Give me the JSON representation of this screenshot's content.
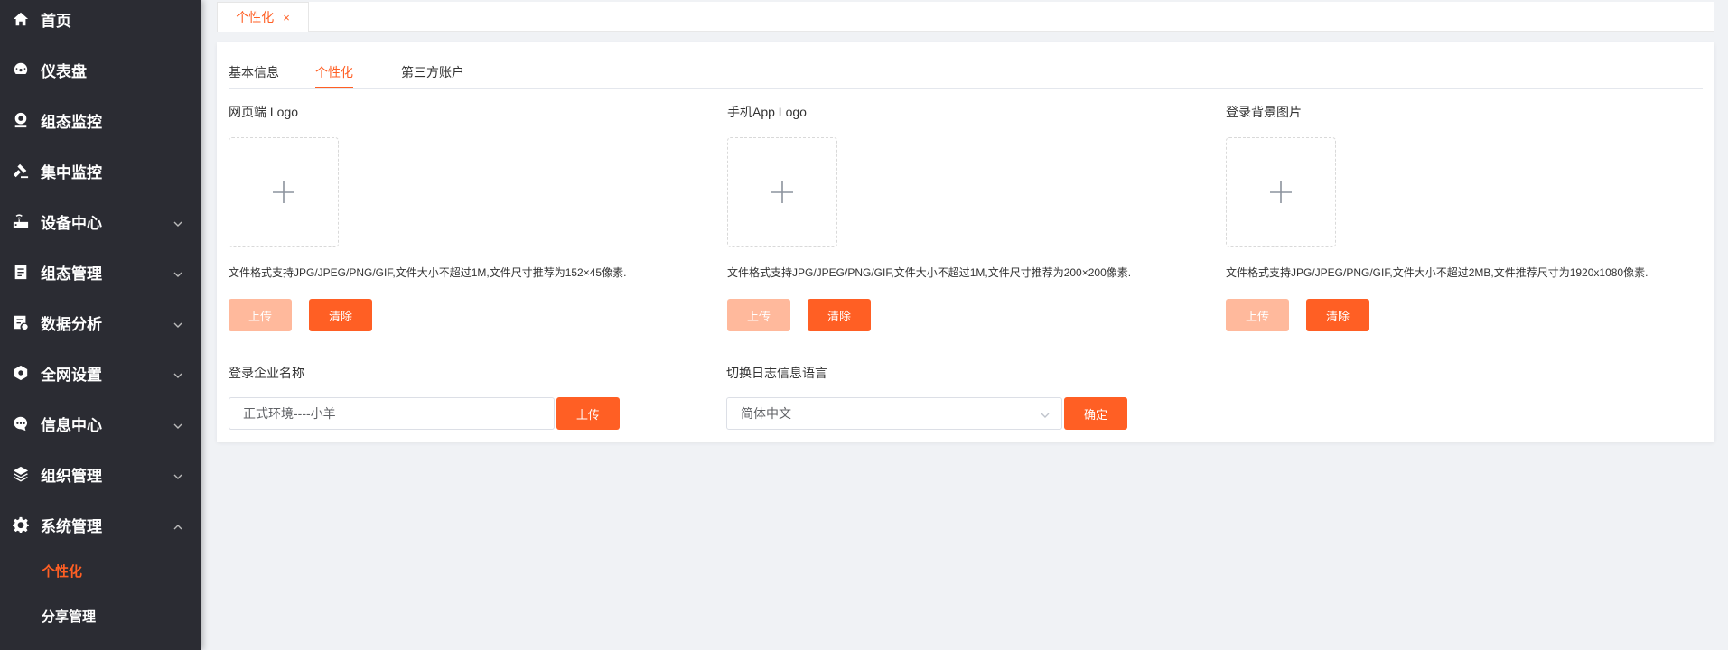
{
  "sidebar": {
    "items": [
      {
        "label": "首页",
        "icon": "home-icon",
        "expandable": false
      },
      {
        "label": "仪表盘",
        "icon": "dashboard-icon",
        "expandable": false
      },
      {
        "label": "组态监控",
        "icon": "webcam-icon",
        "expandable": false
      },
      {
        "label": "集中监控",
        "icon": "hammer-icon",
        "expandable": false
      },
      {
        "label": "设备中心",
        "icon": "router-icon",
        "expandable": true
      },
      {
        "label": "组态管理",
        "icon": "clipboard-icon",
        "expandable": true
      },
      {
        "label": "数据分析",
        "icon": "report-icon",
        "expandable": true
      },
      {
        "label": "全网设置",
        "icon": "hexagon-icon",
        "expandable": true
      },
      {
        "label": "信息中心",
        "icon": "chat-icon",
        "expandable": true
      },
      {
        "label": "组织管理",
        "icon": "layers-icon",
        "expandable": true
      },
      {
        "label": "系统管理",
        "icon": "gear-icon",
        "expandable": true,
        "expanded": true
      }
    ],
    "subitems": [
      {
        "label": "个性化",
        "active": true
      },
      {
        "label": "分享管理",
        "active": false
      }
    ]
  },
  "tagbar": {
    "tag_label": "个性化",
    "close_glyph": "×"
  },
  "tabs": [
    {
      "label": "基本信息",
      "active": false
    },
    {
      "label": "个性化",
      "active": true
    },
    {
      "label": "第三方账户",
      "active": false
    }
  ],
  "uploads": [
    {
      "title": "网页端 Logo",
      "hint": "文件格式支持JPG/JPEG/PNG/GIF,文件大小不超过1M,文件尺寸推荐为152×45像素.",
      "upload_label": "上传",
      "clear_label": "清除"
    },
    {
      "title": "手机App Logo",
      "hint": "文件格式支持JPG/JPEG/PNG/GIF,文件大小不超过1M,文件尺寸推荐为200×200像素.",
      "upload_label": "上传",
      "clear_label": "清除"
    },
    {
      "title": "登录背景图片",
      "hint": "文件格式支持JPG/JPEG/PNG/GIF,文件大小不超过2MB,文件推荐尺寸为1920x1080像素.",
      "upload_label": "上传",
      "clear_label": "清除"
    }
  ],
  "company_name": {
    "label": "登录企业名称",
    "value": "正式环境----小羊",
    "button_label": "上传"
  },
  "log_language": {
    "label": "切换日志信息语言",
    "value": "简体中文",
    "button_label": "确定"
  },
  "colors": {
    "accent": "#ff5f24",
    "accent_disabled": "#ffb99c",
    "sidebar_bg": "#2b2c33",
    "page_bg": "#f0f2f5"
  }
}
